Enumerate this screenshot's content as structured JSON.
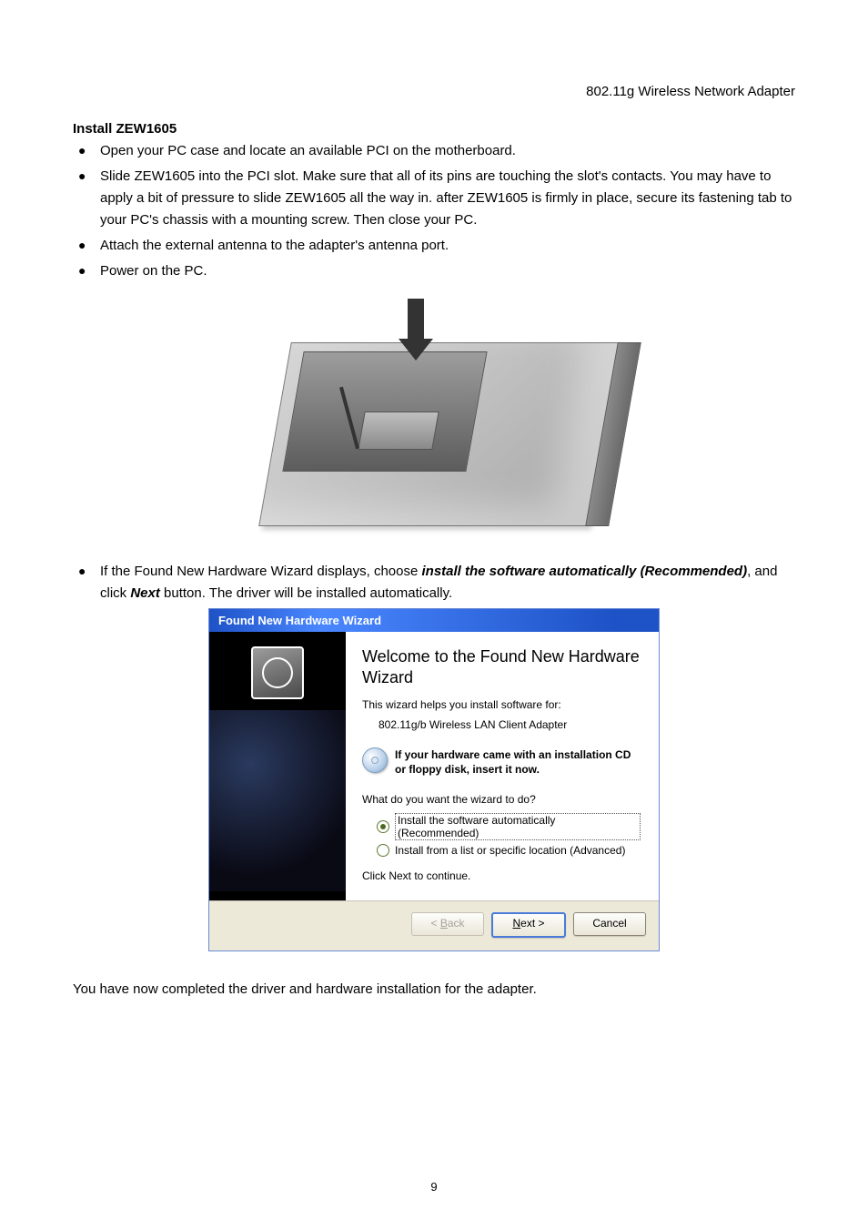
{
  "header": {
    "product": "802.11g Wireless Network Adapter"
  },
  "section_title": "Install ZEW1605",
  "bullets1": [
    "Open your PC case and locate an available PCI on the motherboard.",
    "Slide ZEW1605 into the PCI slot. Make sure that all of its pins are touching the slot's contacts. You may have to apply a bit of pressure to slide ZEW1605 all the way in. after ZEW1605 is firmly in place, secure its fastening tab to your PC's chassis with a mounting screw. Then close your PC.",
    "Attach the external antenna to the adapter's antenna port.",
    "Power on the PC."
  ],
  "bullet2": {
    "pre": "If the Found New Hardware Wizard displays, choose ",
    "bold1": "install the software automatically (Recommended)",
    "mid": ", and click ",
    "bold2": "Next",
    "post": " button. The driver will be installed automatically."
  },
  "wizard": {
    "title": "Found New Hardware Wizard",
    "heading": "Welcome to the Found New Hardware Wizard",
    "helptext": "This wizard helps you install software for:",
    "device": "802.11g/b Wireless LAN Client Adapter",
    "cd_text": "If your hardware came with an installation CD or floppy disk, insert it now.",
    "question": "What do you want the wizard to do?",
    "options": [
      {
        "label": "Install the software automatically (Recommended)",
        "selected": true
      },
      {
        "label": "Install from a list or specific location (Advanced)",
        "selected": false
      }
    ],
    "continue": "Click Next to continue.",
    "buttons": {
      "back": "< Back",
      "back_u": "B",
      "next": "Next >",
      "next_u": "N",
      "cancel": "Cancel"
    }
  },
  "closing": "You have now completed the driver and hardware installation for the adapter.",
  "page_number": "9"
}
